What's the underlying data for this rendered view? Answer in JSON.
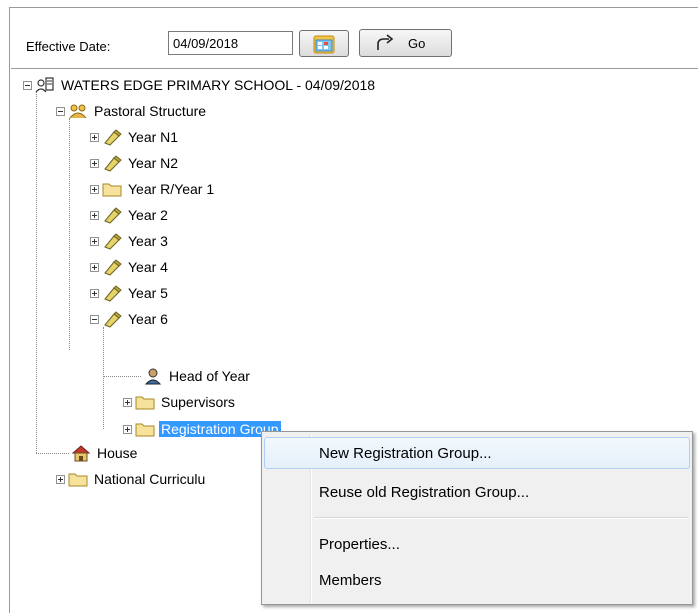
{
  "toolbar": {
    "effective_date_label": "Effective Date:",
    "effective_date_value": "04/09/2018",
    "go_label": "Go"
  },
  "tree": {
    "root": "WATERS EDGE PRIMARY SCHOOL - 04/09/2018",
    "pastoral": "Pastoral Structure",
    "years": [
      "Year N1",
      "Year N2",
      "Year R/Year 1",
      "Year 2",
      "Year 3",
      "Year 4",
      "Year 5",
      "Year 6"
    ],
    "year6_children": [
      "Head of Year",
      "Supervisors",
      "Registration Group"
    ],
    "house": "House",
    "national_curriculum": "National Curriculu"
  },
  "context_menu": {
    "items": [
      "New Registration Group...",
      "Reuse old Registration Group...",
      "Properties...",
      "Members"
    ]
  },
  "colors": {
    "selection": "#3399ff",
    "menu_background": "#f0f0f0",
    "menu_highlight_border": "#aecff7"
  }
}
